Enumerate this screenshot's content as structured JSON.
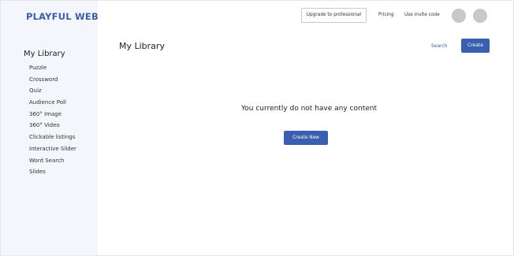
{
  "brand": "PLAYFUL WEB",
  "sidebar": {
    "heading": "My Library",
    "items": [
      {
        "label": "Puzzle"
      },
      {
        "label": "Crossword"
      },
      {
        "label": "Quiz"
      },
      {
        "label": "Audience Poll"
      },
      {
        "label": "360° Image"
      },
      {
        "label": "360° Video"
      },
      {
        "label": "Clickable listings"
      },
      {
        "label": "Interactive Slider"
      },
      {
        "label": "Word Search"
      },
      {
        "label": "Slides"
      }
    ]
  },
  "header": {
    "upgrade_label": "Upgrade to professional",
    "pricing_label": "Pricing",
    "invite_label": "Use invite code"
  },
  "main": {
    "title": "My Library",
    "search_label": "Search",
    "create_label": "Create",
    "empty_message": "You currently do not have any content",
    "create_new_label": "Create New"
  },
  "colors": {
    "accent": "#3a5fb0",
    "sidebar_bg": "#f5f6fb",
    "avatar": "#c8c8c8"
  }
}
